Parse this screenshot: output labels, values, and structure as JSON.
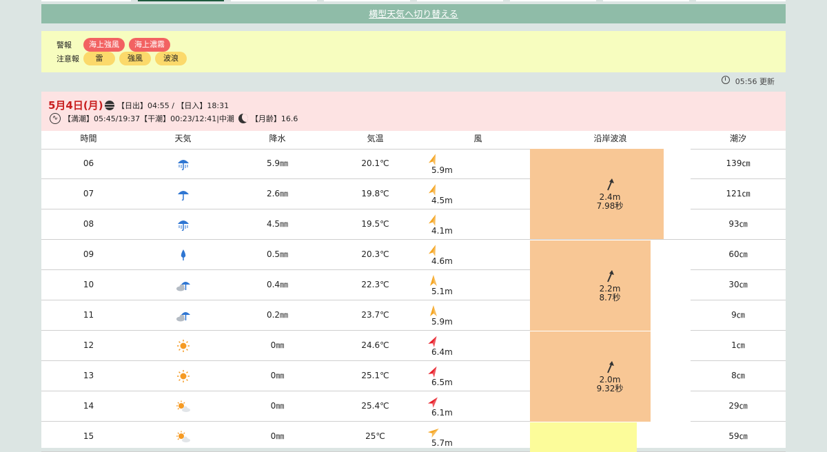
{
  "switch_link": "横型天気へ切り替える",
  "warnings": {
    "warning_label": "警報",
    "warning_items": [
      "海上強風",
      "海上濃霧"
    ],
    "advisory_label": "注意報",
    "advisory_items": [
      "雷",
      "強風",
      "波浪"
    ]
  },
  "update_time": "05:56 更新",
  "day": {
    "title": "5月4日(月)",
    "sunrise": "【日出】04:55 / 【日入】18:31",
    "tide": "【満潮】05:45/19:37【干潮】00:23/12:41|中潮",
    "moon_age": "【月齢】16.6"
  },
  "columns": [
    "時間",
    "天気",
    "降水",
    "気温",
    "風",
    "沿岸波浪",
    "潮汐"
  ],
  "rows": [
    {
      "hour": "06",
      "weather": "rain-umbrella-heavy-icon",
      "precip": "5.9㎜",
      "temp": "20.1℃",
      "wind_speed": "5.9m",
      "wind_color": "#f5a623",
      "wind_rot": 20,
      "tide": "139㎝"
    },
    {
      "hour": "07",
      "weather": "umbrella-icon",
      "precip": "2.6㎜",
      "temp": "19.8℃",
      "wind_speed": "4.5m",
      "wind_color": "#f5a623",
      "wind_rot": 20,
      "tide": "121㎝"
    },
    {
      "hour": "08",
      "weather": "rain-umbrella-heavy-icon",
      "precip": "4.5㎜",
      "temp": "19.5℃",
      "wind_speed": "4.1m",
      "wind_color": "#f5a623",
      "wind_rot": 20,
      "tide": "93㎝"
    },
    {
      "hour": "09",
      "weather": "rain-drop-icon",
      "precip": "0.5㎜",
      "temp": "20.3℃",
      "wind_speed": "4.6m",
      "wind_color": "#f5a623",
      "wind_rot": 20,
      "tide": "60㎝"
    },
    {
      "hour": "10",
      "weather": "cloud-umbrella-icon",
      "precip": "0.4㎜",
      "temp": "22.3℃",
      "wind_speed": "5.1m",
      "wind_color": "#f5a623",
      "wind_rot": 0,
      "tide": "30㎝"
    },
    {
      "hour": "11",
      "weather": "cloud-umbrella-icon",
      "precip": "0.2㎜",
      "temp": "23.7℃",
      "wind_speed": "5.9m",
      "wind_color": "#f5a623",
      "wind_rot": 0,
      "tide": "9㎝"
    },
    {
      "hour": "12",
      "weather": "sun-icon",
      "precip": "0㎜",
      "temp": "24.6℃",
      "wind_speed": "6.4m",
      "wind_color": "#e8202a",
      "wind_rot": 30,
      "tide": "1㎝"
    },
    {
      "hour": "13",
      "weather": "sun-icon",
      "precip": "0㎜",
      "temp": "25.1℃",
      "wind_speed": "6.5m",
      "wind_color": "#e8202a",
      "wind_rot": 30,
      "tide": "8㎝"
    },
    {
      "hour": "14",
      "weather": "sun-cloud-icon",
      "precip": "0㎜",
      "temp": "25.4℃",
      "wind_speed": "6.1m",
      "wind_color": "#e8202a",
      "wind_rot": 40,
      "tide": "29㎝"
    },
    {
      "hour": "15",
      "weather": "sun-cloud-icon",
      "precip": "0㎜",
      "temp": "25℃",
      "wind_speed": "5.7m",
      "wind_color": "#f5a623",
      "wind_rot": 55,
      "tide": "59㎝"
    }
  ],
  "waves": [
    {
      "height": "2.4m",
      "period": "7.98秒"
    },
    {
      "height": "2.2m",
      "period": "8.7秒"
    },
    {
      "height": "2.0m",
      "period": "9.32秒"
    }
  ]
}
